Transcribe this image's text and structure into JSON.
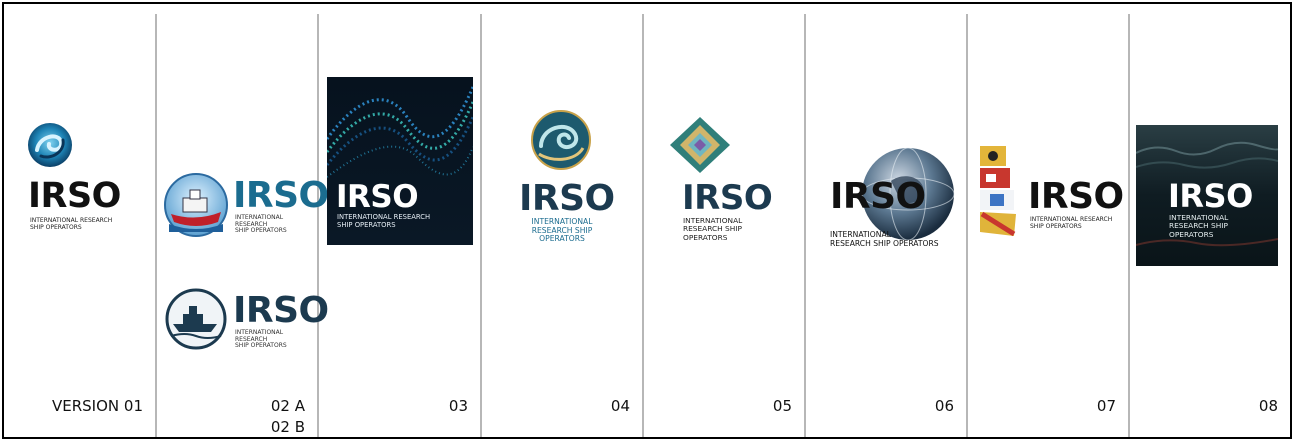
{
  "brand": "IRSO",
  "subtitle_line1": "INTERNATIONAL RESEARCH",
  "subtitle_line2": "SHIP OPERATORS",
  "versions": {
    "v01": "VERSION 01",
    "v02a": "02 A",
    "v02b": "02 B",
    "v03": "03",
    "v04": "04",
    "v05": "05",
    "v06": "06",
    "v07": "07",
    "v08": "08"
  },
  "logo04": {
    "l1": "INTERNATIONAL",
    "l2": "RESEARCH SHIP",
    "l3": "OPERATORS"
  },
  "logo05": {
    "l1": "INTERNATIONAL",
    "l2": "RESEARCH SHIP",
    "l3": "OPERATORS"
  },
  "logo06": {
    "l1": "INTERNATIONAL",
    "l2": "RESEARCH SHIP OPERATORS"
  },
  "logo08": {
    "l1": "INTERNATIONAL",
    "l2": "RESEARCH SHIP",
    "l3": "OPERATORS"
  },
  "colors": {
    "navy": "#1c3a4f",
    "teal_blue": "#1b6c8f",
    "dark_tile": "#0b1622"
  }
}
